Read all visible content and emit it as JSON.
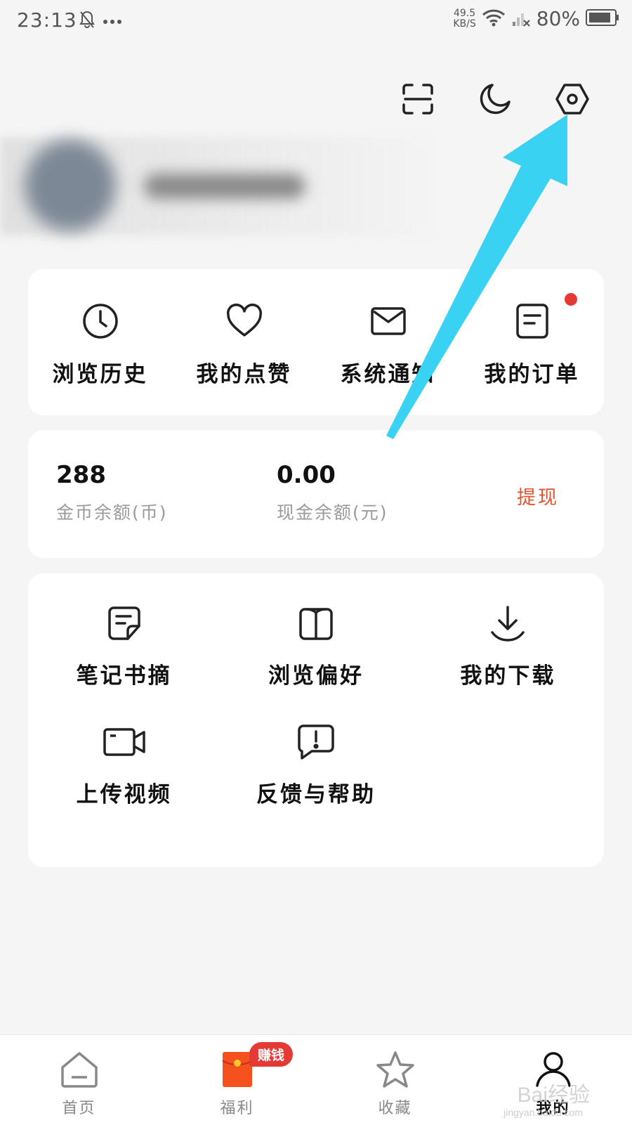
{
  "status_bar": {
    "time": "23:13",
    "net_speed_value": "49.5",
    "net_speed_unit": "KB/S",
    "battery": "80%"
  },
  "top_actions": {
    "icons": [
      "scan-icon",
      "night-mode-icon",
      "settings-icon"
    ]
  },
  "quick_links": [
    {
      "label": "浏览历史",
      "icon": "clock-icon"
    },
    {
      "label": "我的点赞",
      "icon": "heart-icon"
    },
    {
      "label": "系统通知",
      "icon": "mail-icon"
    },
    {
      "label": "我的订单",
      "icon": "order-icon"
    }
  ],
  "balance": {
    "coins_value": "288",
    "coins_label": "金币余额(币)",
    "cash_value": "0.00",
    "cash_label": "现金余额(元)",
    "withdraw_label": "提现"
  },
  "tools": [
    {
      "label": "笔记书摘",
      "icon": "note-icon"
    },
    {
      "label": "浏览偏好",
      "icon": "book-icon"
    },
    {
      "label": "我的下载",
      "icon": "download-icon"
    },
    {
      "label": "上传视频",
      "icon": "video-icon"
    },
    {
      "label": "反馈与帮助",
      "icon": "feedback-icon"
    }
  ],
  "bottom_nav": {
    "items": [
      {
        "label": "首页",
        "icon": "home-icon"
      },
      {
        "label": "福利",
        "icon": "red-envelope-icon"
      },
      {
        "label": "收藏",
        "icon": "star-icon"
      },
      {
        "label": "我的",
        "icon": "user-icon"
      }
    ],
    "earn_badge": "赚钱",
    "active": "我的"
  },
  "watermark": {
    "text": "Bai经验",
    "sub": "jingyan.baidu.com"
  },
  "colors": {
    "accent_red": "#e53935",
    "withdraw": "#e5532f",
    "arrow": "#3ad2f2"
  }
}
